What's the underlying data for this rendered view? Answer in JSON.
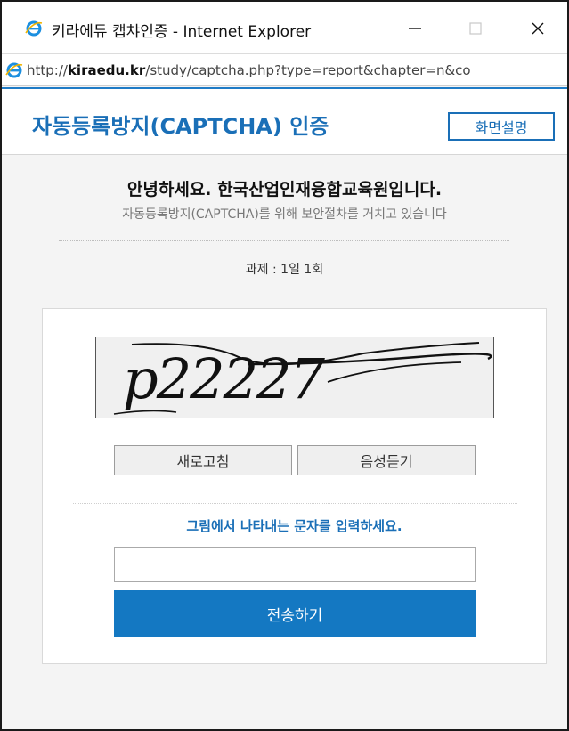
{
  "window": {
    "title": "키라에듀 캡챠인증 - Internet Explorer",
    "url_prefix": "http://",
    "url_domain": "kiraedu.kr",
    "url_suffix": "/study/captcha.php?type=report&chapter=n&co"
  },
  "header": {
    "title": "자동등록방지(CAPTCHA) 인증",
    "help_label": "화면설명"
  },
  "content": {
    "greeting": "안녕하세요. 한국산업인재융합교육원입니다.",
    "sub_greeting": "자동등록방지(CAPTCHA)를 위해 보안절차를 거치고 있습니다",
    "quota": "과제 : 1일 1회",
    "captcha_text": "p22227",
    "refresh_label": "새로고침",
    "audio_label": "음성듣기",
    "instruction": "그림에서 나타내는 문자를 입력하세요.",
    "answer_value": "",
    "answer_placeholder": "",
    "submit_label": "전송하기"
  },
  "colors": {
    "brand_blue": "#1a6fb7",
    "submit_blue": "#1478c2"
  }
}
